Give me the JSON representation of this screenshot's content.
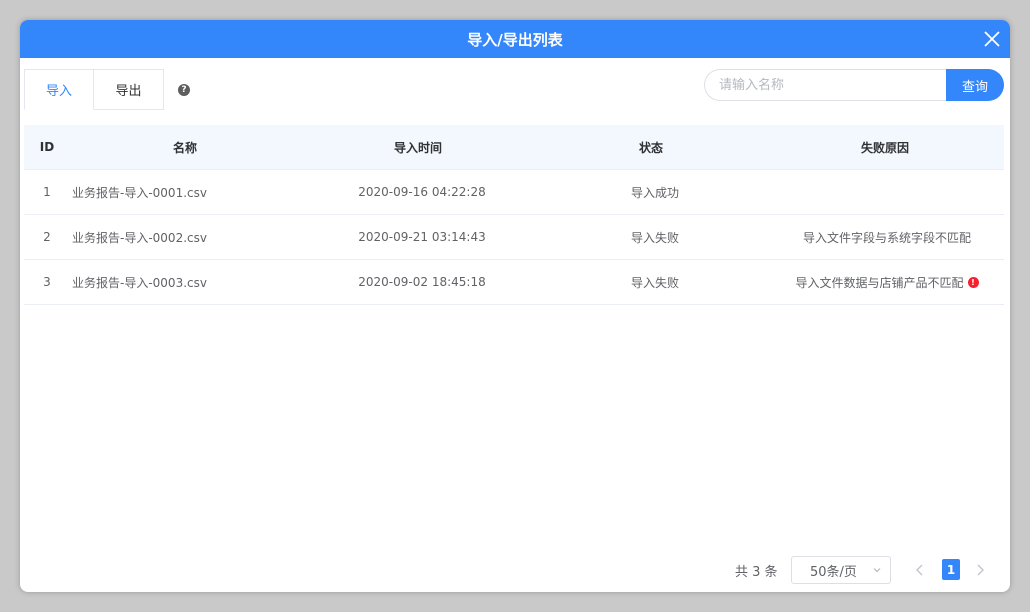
{
  "dialog": {
    "title": "导入/导出列表"
  },
  "tabs": [
    {
      "label": "导入"
    },
    {
      "label": "导出"
    }
  ],
  "search": {
    "placeholder": "请输入名称",
    "value": "",
    "button_label": "查询"
  },
  "table": {
    "columns": [
      "ID",
      "名称",
      "导入时间",
      "状态",
      "失败原因"
    ],
    "rows": [
      {
        "id": "1",
        "name": "业务报告-导入-0001.csv",
        "time": "2020-09-16 04:22:28",
        "status": "导入成功",
        "reason": ""
      },
      {
        "id": "2",
        "name": "业务报告-导入-0002.csv",
        "time": "2020-09-21 03:14:43",
        "status": "导入失败",
        "reason": "导入文件字段与系统字段不匹配"
      },
      {
        "id": "3",
        "name": "业务报告-导入-0003.csv",
        "time": "2020-09-02 18:45:18",
        "status": "导入失败",
        "reason": "导入文件数据与店铺产品不匹配"
      }
    ]
  },
  "pagination": {
    "total": "共 3 条",
    "page_size": "50条/页",
    "current_page": "1"
  },
  "colors": {
    "primary": "#3486fb",
    "error": "#f5222d"
  },
  "icons": {
    "close": "close-icon",
    "help": "question-circle-icon",
    "warning": "exclamation-circle-icon"
  }
}
